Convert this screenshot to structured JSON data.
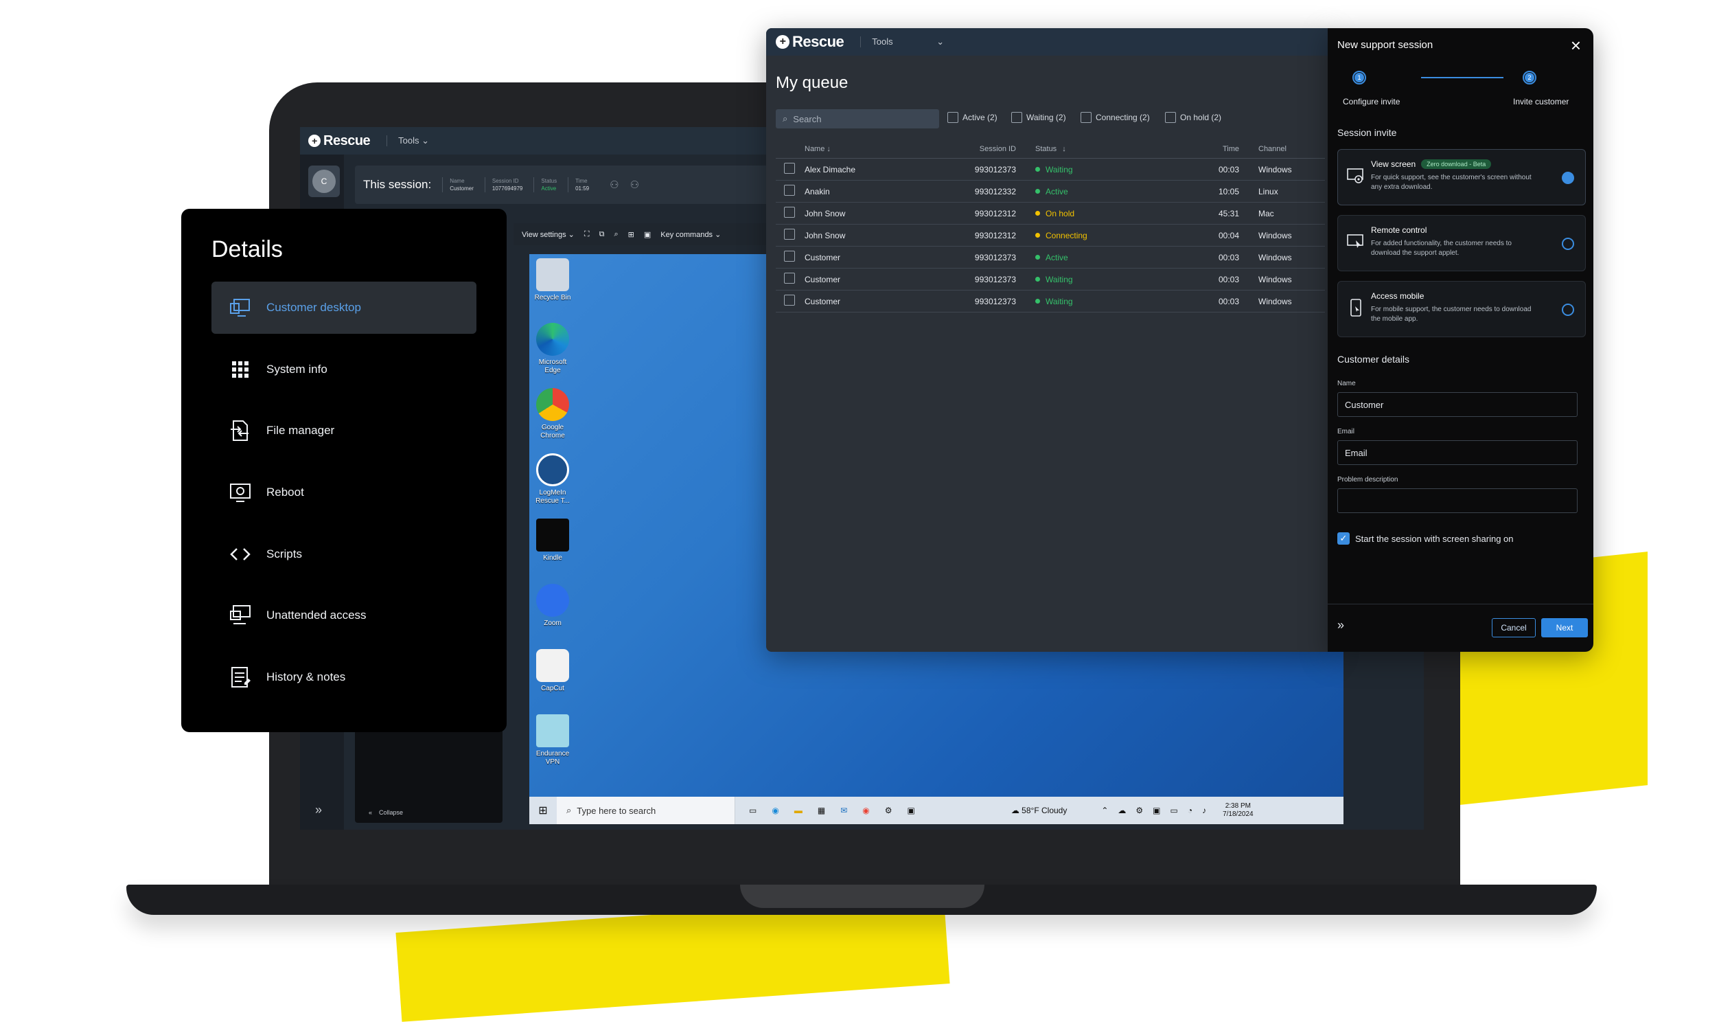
{
  "colors": {
    "accent": "#3b8de0",
    "yellow": "#f6e304",
    "active": "#35c06a",
    "waiting": "#35c06a",
    "on_hold": "#f2c200",
    "connecting": "#f2c200"
  },
  "app": {
    "brand": "Rescue",
    "tools": "Tools"
  },
  "session_bar": {
    "avatar_letter": "C",
    "title": "This session:",
    "fields": [
      {
        "key": "Name",
        "value": "Customer"
      },
      {
        "key": "Session ID",
        "value": "1077694979"
      },
      {
        "key": "Status",
        "value": "Active"
      },
      {
        "key": "Time",
        "value": "01:59"
      }
    ]
  },
  "remote_toolbar": {
    "view_settings": "View settings",
    "key_commands": "Key commands"
  },
  "collapse_label": "Collapse",
  "desktop_icons": [
    "Recycle Bin",
    "Microsoft Edge",
    "Google Chrome",
    "LogMeIn Rescue T...",
    "Kindle",
    "Zoom",
    "CapCut",
    "Endurance VPN"
  ],
  "taskbar": {
    "search_placeholder": "Type here to search",
    "weather": "58°F  Cloudy",
    "time": "2:38 PM",
    "date": "7/18/2024"
  },
  "details": {
    "title": "Details",
    "items": [
      {
        "label": "Customer desktop",
        "icon": "monitor-icon"
      },
      {
        "label": "System info",
        "icon": "grid-icon"
      },
      {
        "label": "File manager",
        "icon": "file-transfer-icon"
      },
      {
        "label": "Reboot",
        "icon": "reboot-monitor-icon"
      },
      {
        "label": "Scripts",
        "icon": "code-icon"
      },
      {
        "label": "Unattended access",
        "icon": "unattended-icon"
      },
      {
        "label": "History & notes",
        "icon": "notes-icon"
      }
    ]
  },
  "queue": {
    "title": "My queue",
    "search_placeholder": "Search",
    "filters": [
      "Active (2)",
      "Waiting (2)",
      "Connecting (2)",
      "On hold (2)"
    ],
    "columns": [
      "Name",
      "Session ID",
      "Status",
      "Time",
      "Channel"
    ],
    "rows": [
      {
        "name": "Alex Dimache",
        "id": "993012373",
        "status": "Waiting",
        "time": "00:03",
        "channel": "Windows"
      },
      {
        "name": "Anakin",
        "id": "993012332",
        "status": "Active",
        "time": "10:05",
        "channel": "Linux"
      },
      {
        "name": "John Snow",
        "id": "993012312",
        "status": "On hold",
        "time": "45:31",
        "channel": "Mac"
      },
      {
        "name": "John Snow",
        "id": "993012312",
        "status": "Connecting",
        "time": "00:04",
        "channel": "Windows"
      },
      {
        "name": "Customer",
        "id": "993012373",
        "status": "Active",
        "time": "00:03",
        "channel": "Windows"
      },
      {
        "name": "Customer",
        "id": "993012373",
        "status": "Waiting",
        "time": "00:03",
        "channel": "Windows"
      },
      {
        "name": "Customer",
        "id": "993012373",
        "status": "Waiting",
        "time": "00:03",
        "channel": "Windows"
      }
    ]
  },
  "new_session": {
    "title": "New support session",
    "steps": [
      {
        "num": "1",
        "label": "Configure invite"
      },
      {
        "num": "2",
        "label": "Invite customer"
      }
    ],
    "session_invite": "Session invite",
    "options": [
      {
        "title": "View screen",
        "badge": "Zero download - Beta",
        "desc": "For quick support, see the customer's screen without any extra download.",
        "selected": true
      },
      {
        "title": "Remote control",
        "badge": "",
        "desc": "For added functionality, the customer needs to download the support applet.",
        "selected": false
      },
      {
        "title": "Access mobile",
        "badge": "",
        "desc": "For mobile support, the customer needs to download the mobile app.",
        "selected": false
      }
    ],
    "customer_details": "Customer details",
    "name_label": "Name",
    "name_value": "Customer",
    "email_label": "Email",
    "email_value": "Email",
    "problem_label": "Problem description",
    "problem_value": "",
    "checkbox_label": "Start the session with screen sharing on",
    "cancel": "Cancel",
    "next": "Next"
  }
}
